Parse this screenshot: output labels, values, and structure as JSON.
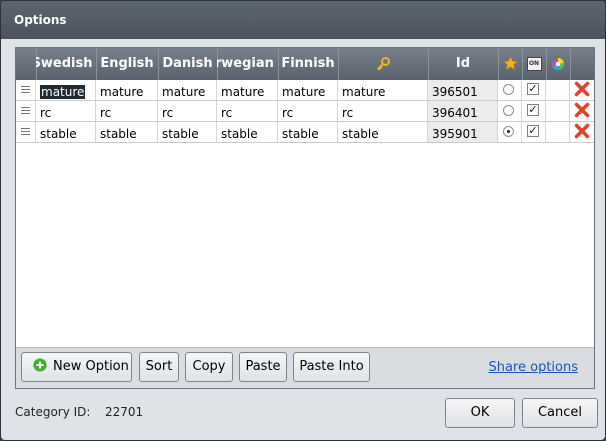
{
  "dialog": {
    "title": "Options"
  },
  "grid": {
    "headers": {
      "swedish": "Swedish",
      "english": "English",
      "danish": "Danish",
      "norwegian": "Norwegian",
      "finnish": "Finnish",
      "id": "Id"
    },
    "icons": {
      "key": "key-icon",
      "default": "star-icon",
      "active": "on-toggle-icon",
      "color": "color-wheel-icon",
      "delete": "delete-x-icon",
      "drag": "drag-handle-icon"
    },
    "rows": [
      {
        "swedish": "mature",
        "english": "mature",
        "danish": "mature",
        "norwegian": "mature",
        "finnish": "mature",
        "key": "mature",
        "id": "396501",
        "default": false,
        "active": true
      },
      {
        "swedish": "rc",
        "english": "rc",
        "danish": "rc",
        "norwegian": "rc",
        "finnish": "rc",
        "key": "rc",
        "id": "396401",
        "default": false,
        "active": true
      },
      {
        "swedish": "stable",
        "english": "stable",
        "danish": "stable",
        "norwegian": "stable",
        "finnish": "stable",
        "key": "stable",
        "id": "395901",
        "default": true,
        "active": true
      }
    ]
  },
  "toolbar": {
    "new_option": "New Option",
    "sort": "Sort",
    "copy": "Copy",
    "paste": "Paste",
    "paste_into": "Paste Into",
    "share": "Share options"
  },
  "footer": {
    "category_label": "Category ID:",
    "category_id": "22701",
    "ok": "OK",
    "cancel": "Cancel"
  },
  "colors": {
    "header": "#5a636d",
    "title": "#4b545e",
    "delete": "#e0432b",
    "star": "#f3b21a",
    "add": "#3fae2a"
  }
}
